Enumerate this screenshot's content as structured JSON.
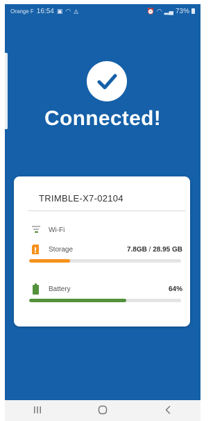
{
  "status_bar": {
    "carrier": "Orange F",
    "time": "16:54",
    "battery_percent": "73%"
  },
  "header": {
    "title": "Connected!"
  },
  "device_card": {
    "device_name": "TRIMBLE-X7-02104",
    "wifi": {
      "label": "Wi-Fi"
    },
    "storage": {
      "label": "Storage",
      "used": "7.8GB",
      "separator": "/",
      "total": "28.95 GB",
      "fill_fraction": 0.27,
      "color": "#f5921e"
    },
    "battery": {
      "label": "Battery",
      "value": "64%",
      "fill_fraction": 0.64,
      "color": "#53913a"
    }
  },
  "colors": {
    "background": "#1560a8",
    "card": "#ffffff"
  },
  "nav": {
    "recents_icon": "recent-apps-icon",
    "home_icon": "home-icon",
    "back_icon": "back-icon"
  }
}
